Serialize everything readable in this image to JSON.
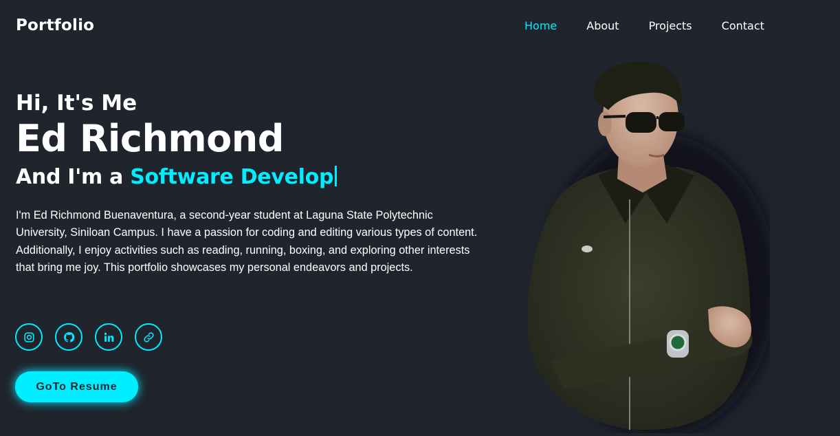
{
  "header": {
    "logo": "Portfolio",
    "nav": [
      {
        "label": "Home",
        "active": true
      },
      {
        "label": "About",
        "active": false
      },
      {
        "label": "Projects",
        "active": false
      },
      {
        "label": "Contact",
        "active": false
      }
    ]
  },
  "hero": {
    "greeting": "Hi, It's Me",
    "name": "Ed Richmond",
    "role_prefix": "And I'm a",
    "role_typed": "Software Develop",
    "description": "I'm Ed Richmond Buenaventura, a second-year student at Laguna State Polytechnic University, Siniloan Campus. I have a passion for coding and editing various types of content. Additionally, I enjoy activities such as reading, running, boxing, and exploring other interests that bring me joy. This portfolio showcases my personal endeavors and projects.",
    "resume_button": "GoTo Resume"
  },
  "social": [
    {
      "icon": "instagram-icon"
    },
    {
      "icon": "github-icon"
    },
    {
      "icon": "linkedin-icon"
    },
    {
      "icon": "link-icon"
    }
  ],
  "colors": {
    "background": "#1f242d",
    "accent": "#00eeff",
    "text": "#ffffff"
  }
}
